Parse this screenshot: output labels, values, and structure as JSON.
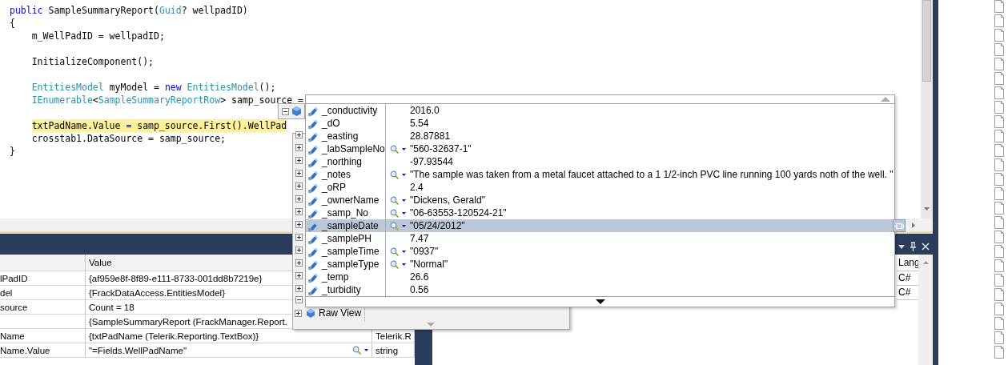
{
  "code_blocks": [
    {
      "lines": [
        {
          "tokens": [
            {
              "kind": "keyword",
              "text": "public"
            },
            {
              "kind": "plain",
              "text": " SampleSummaryReport("
            },
            {
              "kind": "type",
              "text": "Guid"
            },
            {
              "kind": "plain",
              "text": "? wellpadID)"
            }
          ],
          "highlighted": false
        },
        {
          "tokens": [
            {
              "kind": "plain",
              "text": "{"
            }
          ],
          "highlighted": false
        },
        {
          "tokens": [
            {
              "kind": "plain",
              "text": "    m_WellPadID = wellpadID;"
            }
          ],
          "highlighted": false
        }
      ]
    },
    {
      "lines": [
        {
          "tokens": [
            {
              "kind": "plain",
              "text": "    InitializeComponent();"
            }
          ],
          "highlighted": false
        }
      ]
    },
    {
      "lines": [
        {
          "tokens": [
            {
              "kind": "type",
              "text": "    EntitiesModel"
            },
            {
              "kind": "plain",
              "text": " myModel = "
            },
            {
              "kind": "keyword",
              "text": "new"
            },
            {
              "kind": "type",
              "text": " EntitiesModel"
            },
            {
              "kind": "plain",
              "text": "();"
            }
          ],
          "highlighted": false
        },
        {
          "tokens": [
            {
              "kind": "type",
              "text": "    IEnumerable"
            },
            {
              "kind": "plain",
              "text": "<"
            },
            {
              "kind": "type",
              "text": "SampleSummaryReportRow"
            },
            {
              "kind": "plain",
              "text": "> samp_source ="
            }
          ],
          "highlighted": false
        }
      ]
    },
    {
      "lines": [
        {
          "tokens": [
            {
              "kind": "plain",
              "text": "    txtPadName.Value = samp_source.First().WellPad"
            }
          ],
          "highlighted": true
        },
        {
          "tokens": [
            {
              "kind": "plain",
              "text": "    crosstab1.DataSource = samp_source;"
            }
          ],
          "highlighted": false
        },
        {
          "tokens": [
            {
              "kind": "plain",
              "text": "}"
            }
          ],
          "highlighted": false
        }
      ]
    }
  ],
  "datatip": {
    "fields": [
      {
        "name": "_conductivity",
        "value": "2016.0",
        "visualizer": false,
        "expandable": false,
        "selected": false
      },
      {
        "name": "_dO",
        "value": "5.54",
        "visualizer": false,
        "expandable": false,
        "selected": false
      },
      {
        "name": "_easting",
        "value": "28.87881",
        "visualizer": false,
        "expandable": true,
        "selected": false
      },
      {
        "name": "_labSampleNo",
        "value": "\"560-32637-1\"",
        "visualizer": true,
        "expandable": true,
        "selected": false
      },
      {
        "name": "_northing",
        "value": "-97.93544",
        "visualizer": false,
        "expandable": true,
        "selected": false
      },
      {
        "name": "_notes",
        "value": "\"The sample was taken from a metal faucet attached to a 1 1/2-inch PVC line running 100 yards noth of the well. \"",
        "visualizer": true,
        "expandable": true,
        "selected": false
      },
      {
        "name": "_oRP",
        "value": "2.4",
        "visualizer": false,
        "expandable": true,
        "selected": false
      },
      {
        "name": "_ownerName",
        "value": "\"Dickens, Gerald\"",
        "visualizer": true,
        "expandable": true,
        "selected": false
      },
      {
        "name": "_samp_No",
        "value": "\"06-63553-120524-21\"",
        "visualizer": true,
        "expandable": true,
        "selected": false
      },
      {
        "name": "_sampleDate",
        "value": "\"05/24/2012\"",
        "visualizer": true,
        "expandable": true,
        "selected": true
      },
      {
        "name": "_samplePH",
        "value": "7.47",
        "visualizer": false,
        "expandable": true,
        "selected": false
      },
      {
        "name": "_sampleTime",
        "value": "\"0937\"",
        "visualizer": true,
        "expandable": true,
        "selected": false
      },
      {
        "name": "_sampleType",
        "value": "\"Normal\"",
        "visualizer": true,
        "expandable": true,
        "selected": false
      },
      {
        "name": "_temp",
        "value": "26.6",
        "visualizer": false,
        "expandable": true,
        "selected": false
      },
      {
        "name": "_turbidity",
        "value": "0.56",
        "visualizer": false,
        "expandable": true,
        "selected": false
      }
    ],
    "raw_view": "Raw View"
  },
  "watch": {
    "value_header": "Value",
    "rows": [
      {
        "name": "lPadID",
        "value": "{af959e8f-8f89-e111-8733-001dd8b7219e}",
        "visualizer": false
      },
      {
        "name": "del",
        "value": "{FrackDataAccess.EntitiesModel}",
        "visualizer": false
      },
      {
        "name": "source",
        "value": "Count = 18",
        "visualizer": false
      },
      {
        "value": "{SampleSummaryReport (FrackManager.Report.",
        "visualizer": false
      },
      {
        "name": "Name",
        "value": "{txtPadName (Telerik.Reporting.TextBox)}",
        "type": "Telerik.R",
        "visualizer": false
      },
      {
        "name": "Name.Value",
        "value": "\"=Fields.WellPadName\"",
        "type": "string",
        "visualizer": true
      }
    ]
  },
  "side_pane": {
    "header": "Lang",
    "rows": [
      "C#",
      "C#"
    ]
  }
}
